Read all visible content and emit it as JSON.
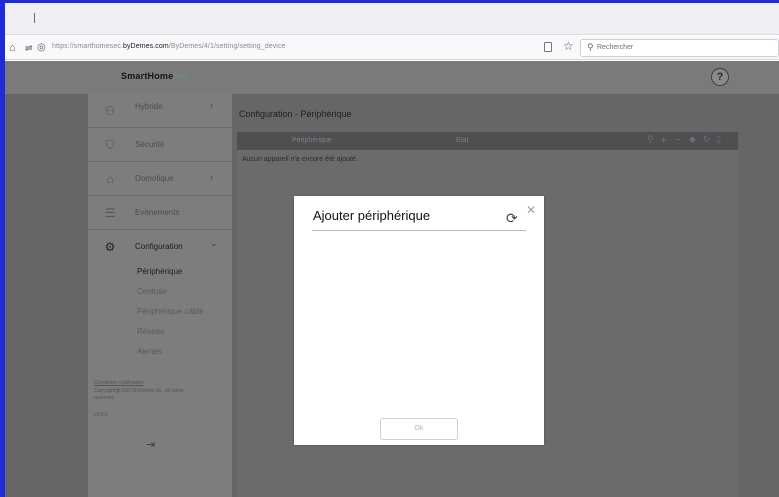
{
  "browser": {
    "url_prefix": "https://smarthomesec.",
    "url_domain": "byDemes.com",
    "url_path": "/ByDemes/4/1/setting/setting_device",
    "search_placeholder": "Rechercher"
  },
  "app": {
    "logo_main": "SmartHome",
    "logo_sec": "Sec",
    "help_label": "?"
  },
  "sidebar": {
    "items": [
      {
        "label": "Hybride",
        "icon": "hybrid-icon",
        "chevron": "›"
      },
      {
        "label": "Sécurité",
        "icon": "shield-icon",
        "chevron": ""
      },
      {
        "label": "Domotique",
        "icon": "home-icon",
        "chevron": "›"
      },
      {
        "label": "Evènements",
        "icon": "list-icon",
        "chevron": ""
      },
      {
        "label": "Configuration",
        "icon": "gear-icon",
        "chevron": "⌄"
      }
    ],
    "sub_items": [
      "Périphérique",
      "Centrale",
      "Périphérique câblé",
      "Réseau",
      "Alertes"
    ],
    "footer": {
      "terms": "Conditions d'utilisation",
      "copyright": "Copyright@2020 ByDemes SL. All rights reserved.",
      "version": "v3.8.0"
    }
  },
  "main": {
    "title": "Configuration - Périphérique",
    "columns": [
      "Périphérique",
      "Etat"
    ],
    "empty_message": "Aucun appareil n'a encore été ajouté."
  },
  "modal": {
    "title": "Ajouter périphérique",
    "ok_label": "Ok"
  }
}
